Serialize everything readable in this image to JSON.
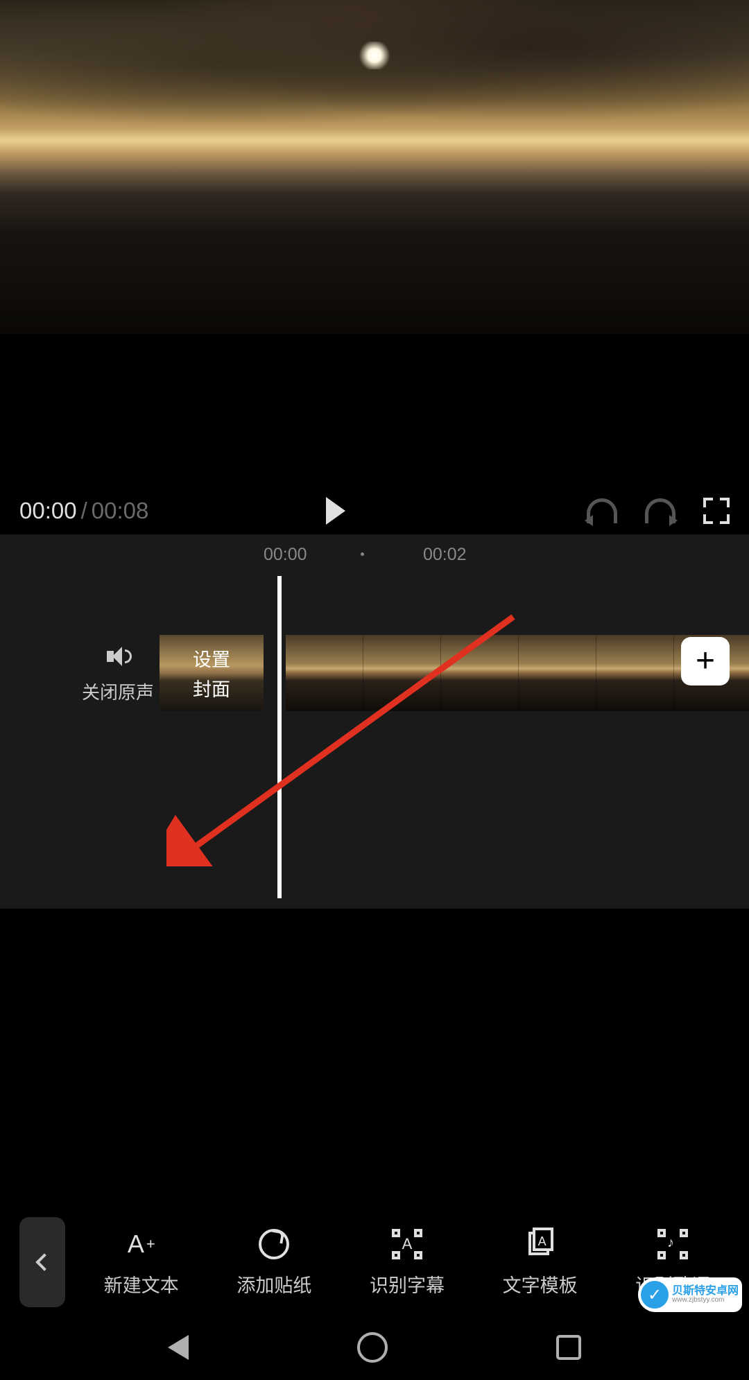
{
  "playback": {
    "current": "00:00",
    "sep": "/",
    "total": "00:08"
  },
  "timeline": {
    "marks": [
      "00:00",
      "00:02"
    ],
    "mute_label": "关闭原声",
    "cover_label_l1": "设置",
    "cover_label_l2": "封面"
  },
  "tools": [
    {
      "id": "new-text",
      "label": "新建文本"
    },
    {
      "id": "add-sticker",
      "label": "添加贴纸"
    },
    {
      "id": "recognize-subtitles",
      "label": "识别字幕"
    },
    {
      "id": "text-template",
      "label": "文字模板"
    },
    {
      "id": "recognize-lyrics",
      "label": "识别歌词"
    }
  ],
  "watermark": {
    "title": "贝斯特安卓网",
    "url": "www.zjbstyy.com"
  },
  "colors": {
    "arrow": "#e03020",
    "accent_white": "#ffffff",
    "bg_timeline": "#1a1a1a"
  }
}
